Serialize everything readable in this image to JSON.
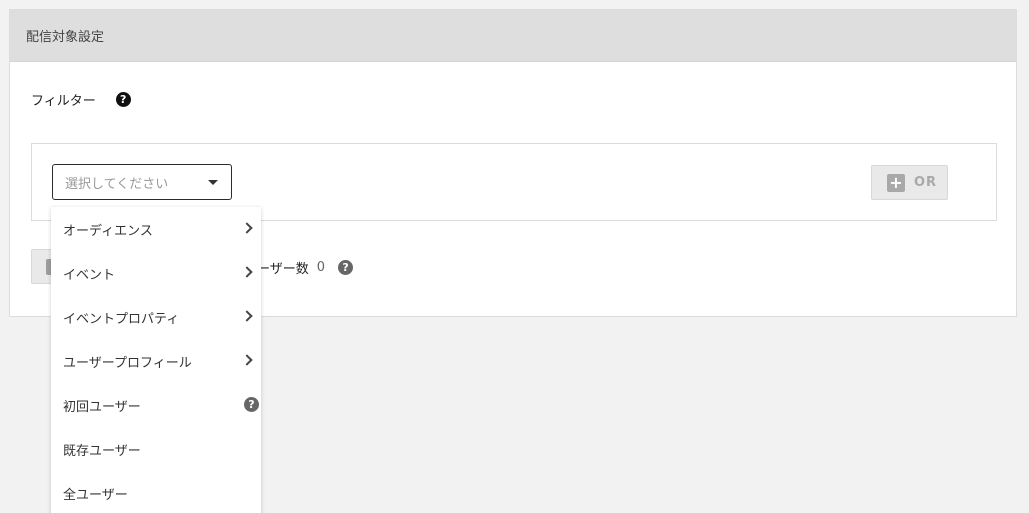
{
  "section": {
    "title": "配信対象設定"
  },
  "filter": {
    "label": "フィルター",
    "help_glyph": "?",
    "select_placeholder": "選択してください",
    "or_button": {
      "icon_glyph": "+",
      "label": "OR"
    }
  },
  "user_count": {
    "label": "ーザー数",
    "value": "0",
    "help_glyph": "?"
  },
  "dropdown": {
    "items": [
      {
        "label": "オーディエンス",
        "has_submenu": true
      },
      {
        "label": "イベント",
        "has_submenu": true
      },
      {
        "label": "イベントプロパティ",
        "has_submenu": true
      },
      {
        "label": "ユーザープロフィール",
        "has_submenu": true
      },
      {
        "label": "初回ユーザー",
        "help_glyph": "?"
      },
      {
        "label": "既存ユーザー"
      },
      {
        "label": "全ユーザー"
      }
    ]
  },
  "colors": {
    "header_bg": "#dedede",
    "page_bg": "#f2f2f2",
    "disabled_grey": "#a9a9a9"
  }
}
